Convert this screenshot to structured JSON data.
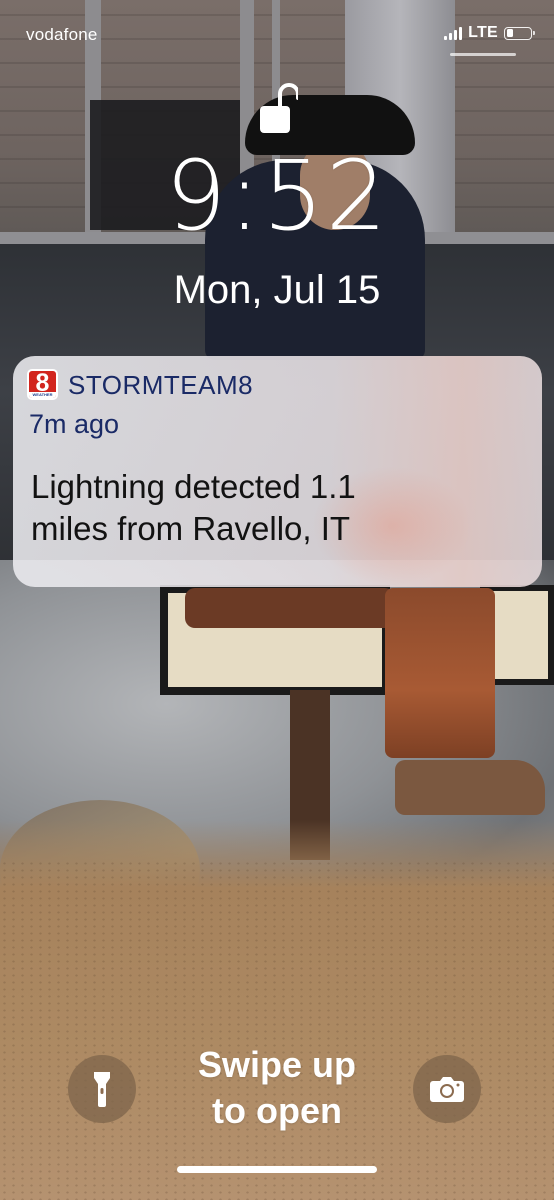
{
  "status_bar": {
    "carrier": "vodafone",
    "network": "LTE",
    "signal_bars": 4,
    "battery_level": 0.25
  },
  "lock_screen": {
    "lock_state": "unlocked",
    "time": "9:52",
    "date": "Mon, Jul 15"
  },
  "notification": {
    "app_icon": {
      "number": "8",
      "label": "WEATHER",
      "color": "#d2251e"
    },
    "app_name": "STORMTEAM8",
    "time_ago": "7m ago",
    "body_line1": "Lightning detected 1.1",
    "body_line2": "miles from Ravello, IT"
  },
  "bottom": {
    "flashlight_icon": "flashlight-icon",
    "camera_icon": "camera-icon",
    "swipe_line1": "Swipe up",
    "swipe_line2": "to open"
  }
}
